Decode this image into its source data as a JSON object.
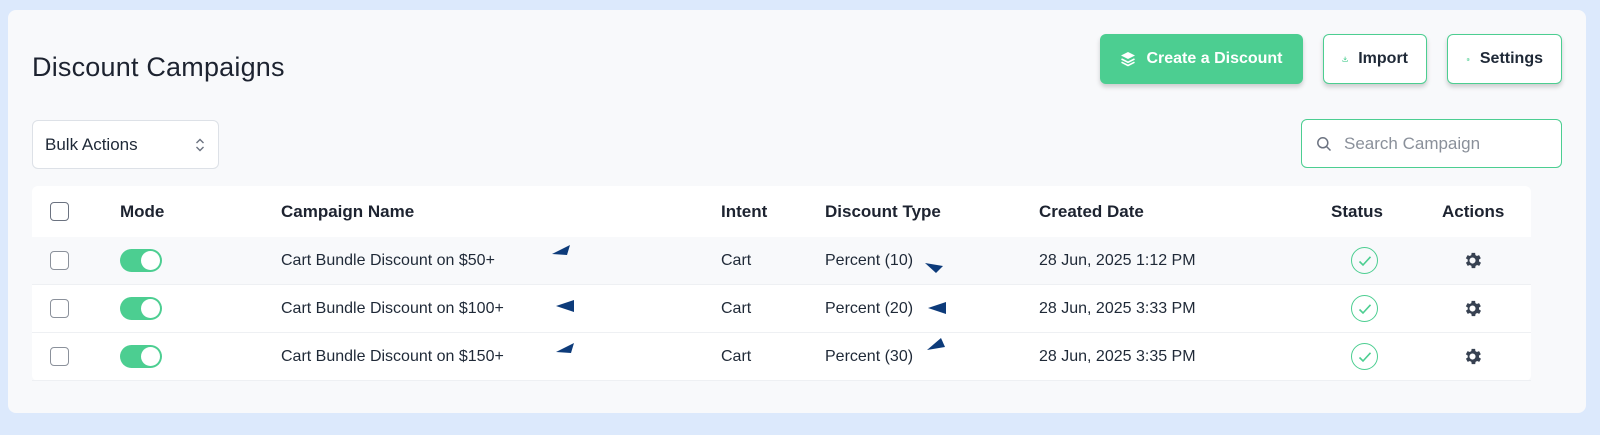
{
  "header": {
    "title": "Discount Campaigns",
    "create_label": "Create a Discount",
    "import_label": "Import",
    "settings_label": "Settings"
  },
  "filters": {
    "bulk_label": "Bulk Actions",
    "search_placeholder": "Search Campaign"
  },
  "table": {
    "columns": {
      "mode": "Mode",
      "name": "Campaign Name",
      "intent": "Intent",
      "type": "Discount Type",
      "date": "Created Date",
      "status": "Status",
      "actions": "Actions"
    },
    "rows": [
      {
        "name": "Cart Bundle Discount on $50+",
        "intent": "Cart",
        "type": "Percent (10)",
        "date": "28 Jun, 2025 1:12 PM",
        "mode_on": true,
        "status": "active"
      },
      {
        "name": "Cart Bundle Discount on $100+",
        "intent": "Cart",
        "type": "Percent (20)",
        "date": "28 Jun, 2025 3:33 PM",
        "mode_on": true,
        "status": "active"
      },
      {
        "name": "Cart Bundle Discount on $150+",
        "intent": "Cart",
        "type": "Percent (30)",
        "date": "28 Jun, 2025 3:35 PM",
        "mode_on": true,
        "status": "active"
      }
    ]
  },
  "colors": {
    "accent": "#4cce91",
    "background": "#dce9fc",
    "panel": "#f8f9fb",
    "marker": "#0d3b7a"
  },
  "icons": {
    "create": "stack-layers-icon",
    "import": "download-icon",
    "settings": "gear-icon",
    "bulk": "updown-chevron-icon",
    "search": "search-icon",
    "status": "check-circle-icon",
    "actions": "gear-icon"
  }
}
